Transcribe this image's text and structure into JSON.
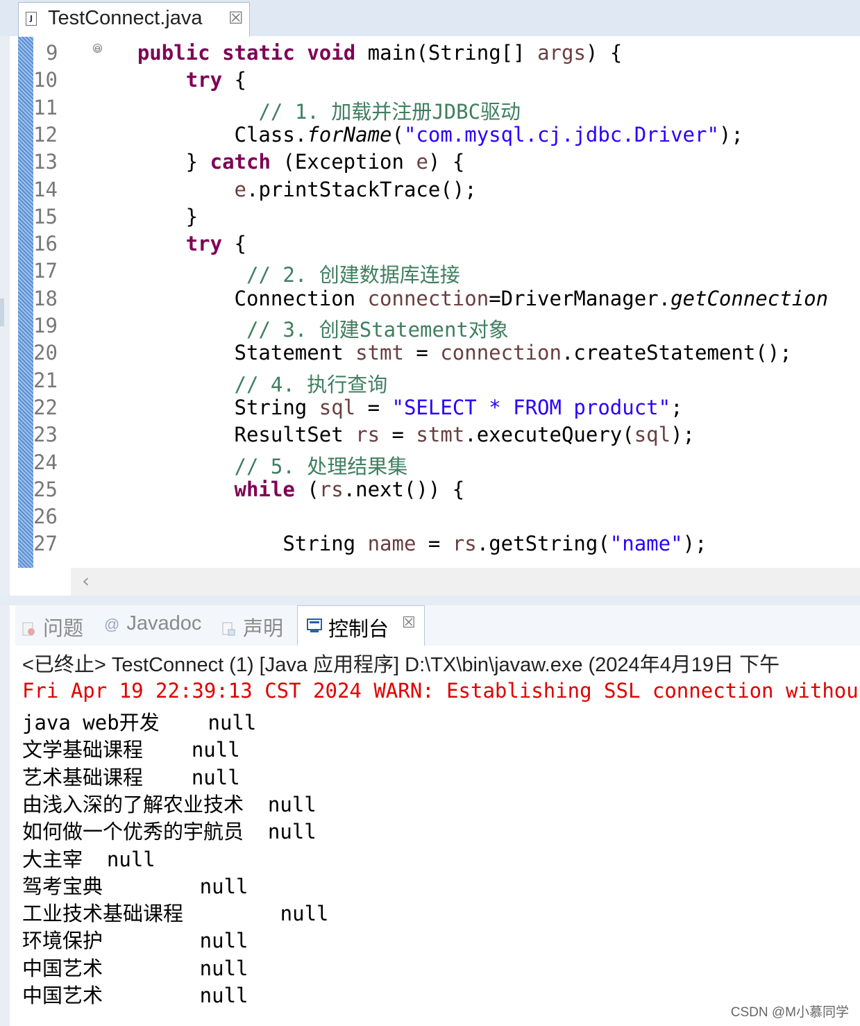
{
  "editor": {
    "tab_title": "TestConnect.java",
    "tab_close": "☒",
    "fold_icon": "⊖",
    "line_numbers": [
      "9",
      "10",
      "11",
      "12",
      "13",
      "14",
      "15",
      "16",
      "17",
      "18",
      "19",
      "20",
      "21",
      "22",
      "23",
      "24",
      "25",
      "26",
      "27"
    ],
    "lines": [
      [
        {
          "t": "    "
        },
        {
          "t": "public",
          "c": "kw"
        },
        {
          "t": " "
        },
        {
          "t": "static",
          "c": "kw"
        },
        {
          "t": " "
        },
        {
          "t": "void",
          "c": "kw"
        },
        {
          "t": " main(String[] "
        },
        {
          "t": "args",
          "c": "var"
        },
        {
          "t": ") {"
        }
      ],
      [
        {
          "t": "        "
        },
        {
          "t": "try",
          "c": "kw"
        },
        {
          "t": " {"
        }
      ],
      [
        {
          "t": "              "
        },
        {
          "t": "// 1. 加载并注册JDBC驱动",
          "c": "cmt"
        }
      ],
      [
        {
          "t": "            Class."
        },
        {
          "t": "forName",
          "c": "ital"
        },
        {
          "t": "("
        },
        {
          "t": "\"com.mysql.cj.jdbc.Driver\"",
          "c": "str"
        },
        {
          "t": ");"
        }
      ],
      [
        {
          "t": "        } "
        },
        {
          "t": "catch",
          "c": "kw"
        },
        {
          "t": " (Exception "
        },
        {
          "t": "e",
          "c": "var"
        },
        {
          "t": ") {"
        }
      ],
      [
        {
          "t": "            "
        },
        {
          "t": "e",
          "c": "var"
        },
        {
          "t": ".printStackTrace();"
        }
      ],
      [
        {
          "t": "        }"
        }
      ],
      [
        {
          "t": "        "
        },
        {
          "t": "try",
          "c": "kw"
        },
        {
          "t": " {"
        }
      ],
      [
        {
          "t": "             "
        },
        {
          "t": "// 2. 创建数据库连接",
          "c": "cmt"
        }
      ],
      [
        {
          "t": "            Connection "
        },
        {
          "t": "connection",
          "c": "var"
        },
        {
          "t": "=DriverManager."
        },
        {
          "t": "getConnection",
          "c": "ital"
        }
      ],
      [
        {
          "t": "             "
        },
        {
          "t": "// 3. 创建Statement对象",
          "c": "cmt"
        }
      ],
      [
        {
          "t": "            Statement "
        },
        {
          "t": "stmt",
          "c": "var"
        },
        {
          "t": " = "
        },
        {
          "t": "connection",
          "c": "var"
        },
        {
          "t": ".createStatement();"
        }
      ],
      [
        {
          "t": "            "
        },
        {
          "t": "// 4. 执行查询",
          "c": "cmt"
        }
      ],
      [
        {
          "t": "            String "
        },
        {
          "t": "sql",
          "c": "var"
        },
        {
          "t": " = "
        },
        {
          "t": "\"SELECT * FROM product\"",
          "c": "str"
        },
        {
          "t": ";"
        }
      ],
      [
        {
          "t": "            ResultSet "
        },
        {
          "t": "rs",
          "c": "var"
        },
        {
          "t": " = "
        },
        {
          "t": "stmt",
          "c": "var"
        },
        {
          "t": ".executeQuery("
        },
        {
          "t": "sql",
          "c": "var"
        },
        {
          "t": ");"
        }
      ],
      [
        {
          "t": "            "
        },
        {
          "t": "// 5. 处理结果集",
          "c": "cmt"
        }
      ],
      [
        {
          "t": "            "
        },
        {
          "t": "while",
          "c": "kw"
        },
        {
          "t": " ("
        },
        {
          "t": "rs",
          "c": "var"
        },
        {
          "t": ".next()) {"
        }
      ],
      [
        {
          "t": ""
        }
      ],
      [
        {
          "t": "                String "
        },
        {
          "t": "name",
          "c": "var"
        },
        {
          "t": " = "
        },
        {
          "t": "rs",
          "c": "var"
        },
        {
          "t": ".getString("
        },
        {
          "t": "\"name\"",
          "c": "str"
        },
        {
          "t": ");"
        }
      ]
    ]
  },
  "console_tabs": {
    "problems": "问题",
    "javadoc": "Javadoc",
    "declaration": "声明",
    "console": "控制台",
    "close": "☒"
  },
  "console": {
    "header": "<已终止> TestConnect (1)  [Java 应用程序] D:\\TX\\bin\\javaw.exe  (2024年4月19日 下午",
    "warning": "Fri Apr 19 22:39:13 CST 2024 WARN: Establishing SSL connection withou",
    "rows": [
      "java web开发\tnull",
      "文学基础课程\tnull",
      "艺术基础课程\tnull",
      "由浅入深的了解农业技术\tnull",
      "如何做一个优秀的宇航员\tnull",
      "大主宰\tnull",
      "驾考宝典\tnull",
      "工业技术基础课程\tnull",
      "环境保护\tnull",
      "中国艺术\tnull",
      "中国艺术\tnull"
    ]
  },
  "watermark": "CSDN @M小慕同学",
  "colors": {
    "keyword": "#7f0055",
    "string": "#2a00ff",
    "comment": "#3f7f5f",
    "variable": "#6a3e3e",
    "error": "#e00000"
  }
}
